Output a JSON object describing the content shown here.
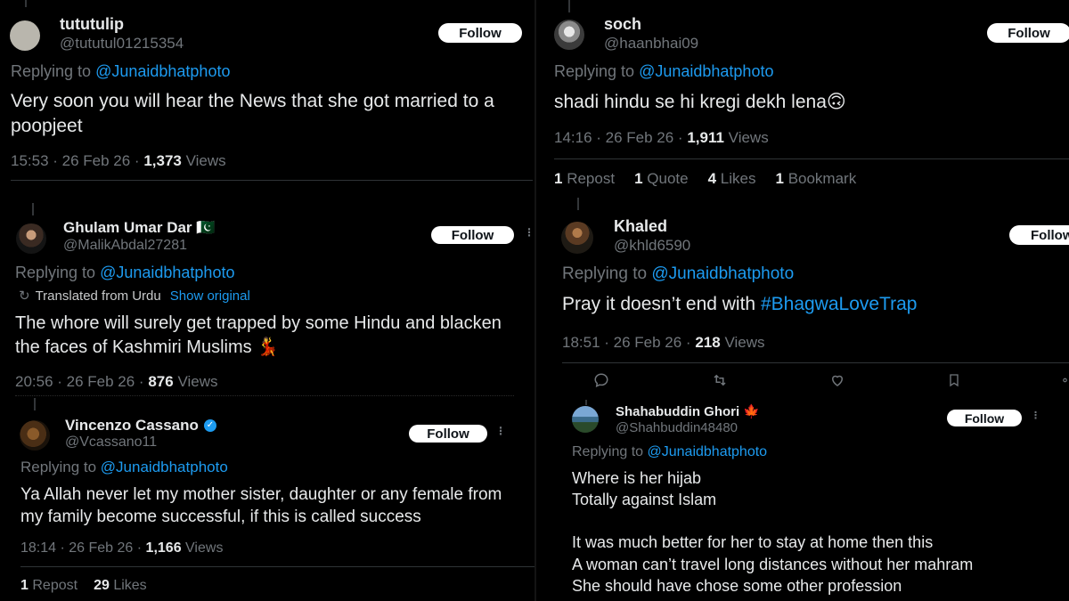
{
  "posts": {
    "p1": {
      "name": "tututulip",
      "handle": "@tututul01215354",
      "follow": "Follow",
      "replying_prefix": "Replying to",
      "replying_handle": "@Junaidbhatphoto",
      "body": "Very soon you will hear the News that she got married to a poopjeet",
      "time": "15:53 · 26 Feb 26 ·",
      "views_num": "1,373",
      "views_label": "Views"
    },
    "p2": {
      "name": "soch",
      "handle": "@haanbhai09",
      "follow": "Follow",
      "replying_prefix": "Replying to",
      "replying_handle": "@Junaidbhatphoto",
      "body": "shadi hindu se hi kregi dekh lena🙃",
      "time": "14:16 · 26 Feb 26 ·",
      "views_num": "1,911",
      "views_label": "Views",
      "stats": [
        {
          "num": "1",
          "label": "Repost"
        },
        {
          "num": "1",
          "label": "Quote"
        },
        {
          "num": "4",
          "label": "Likes"
        },
        {
          "num": "1",
          "label": "Bookmark"
        }
      ]
    },
    "p3": {
      "name": "Ghulam Umar Dar 🇵🇰",
      "handle": "@MalikAbdal27281",
      "follow": "Follow",
      "replying_prefix": "Replying to",
      "replying_handle": "@Junaidbhatphoto",
      "translated": "Translated from Urdu",
      "show_original": "Show original",
      "body": "The whore will surely get trapped by some Hindu and blacken the faces of Kashmiri Muslims 💃",
      "time": "20:56 · 26 Feb 26 ·",
      "views_num": "876",
      "views_label": "Views"
    },
    "p4": {
      "name": "Khaled",
      "handle": "@khld6590",
      "follow": "Follow",
      "replying_prefix": "Replying to",
      "replying_handle": "@Junaidbhatphoto",
      "body_text": "Pray it doesn’t end with ",
      "hashtag": "#BhagwaLoveTrap",
      "time": "18:51 · 26 Feb 26 ·",
      "views_num": "218",
      "views_label": "Views"
    },
    "p5": {
      "name": "Vincenzo Cassano",
      "handle": "@Vcassano11",
      "follow": "Follow",
      "replying_prefix": "Replying to",
      "replying_handle": "@Junaidbhatphoto",
      "body": "Ya Allah never let my mother sister, daughter or any female from my family become successful, if this is called success",
      "time": "18:14 · 26 Feb 26 ·",
      "views_num": "1,166",
      "views_label": "Views",
      "stats": [
        {
          "num": "1",
          "label": "Repost"
        },
        {
          "num": "29",
          "label": "Likes"
        }
      ]
    },
    "p6": {
      "name": "Shahabuddin Ghori 🍁",
      "handle": "@Shahbuddin48480",
      "follow": "Follow",
      "replying_prefix": "Replying to",
      "replying_handle": "@Junaidbhatphoto",
      "lines": [
        "Where is her hijab",
        "Totally against Islam",
        "",
        "It was much better for her to stay at home then this",
        "A woman can’t travel long distances without her mahram",
        "She should have chose some other profession"
      ]
    }
  },
  "icons": [
    "reply-icon",
    "repost-icon",
    "like-icon",
    "bookmark-icon",
    "share-icon",
    "translate-icon",
    "verified-badge-icon",
    "more-icon"
  ],
  "colors": {
    "background": "#000000",
    "text": "#e7e9ea",
    "secondary": "#71767b",
    "link": "#1d9bf0",
    "divider": "#2f3336"
  }
}
